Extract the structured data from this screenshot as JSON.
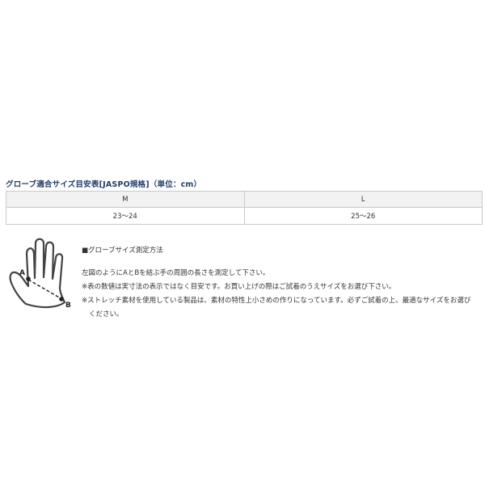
{
  "title": "グローブ適合サイズ目安表[JASPO規格]（単位：cm）",
  "table": {
    "headers": [
      "M",
      "L"
    ],
    "rows": [
      [
        "23〜24",
        "25〜26"
      ]
    ]
  },
  "diagram": {
    "label_a": "A",
    "label_b": "B"
  },
  "notes": {
    "heading": "■グローブサイズ測定方法",
    "lines": [
      "左図のようにAとBを結ぶ手の周囲の長さを測定して下さい。",
      "※表の数値は実寸法の表示ではなく目安です。お買い上げの際はご試着のうえサイズをお選び下さい。",
      "※ストレッチ素材を使用している製品は、素材の特性上小さめの作りになっています。必ずご試着の上、最適なサイズをお選び",
      "ください。"
    ]
  },
  "colors": {
    "title": "#1f3e6e",
    "header_bg": "#f2f2f2",
    "border": "#c9c9c9",
    "text": "#333333"
  }
}
